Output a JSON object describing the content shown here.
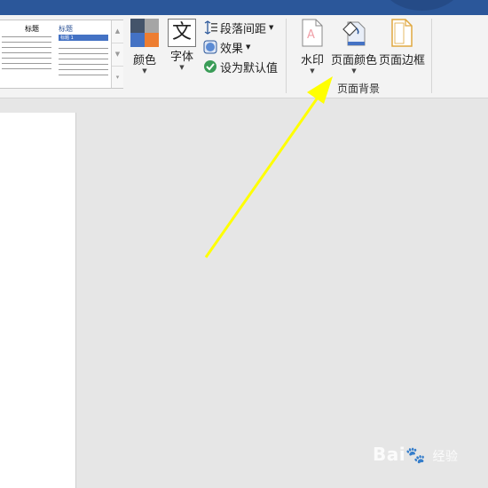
{
  "ribbon": {
    "styles_gallery": {
      "theme1_title": "标题",
      "theme2_title": "标题",
      "theme2_heading": "标题 1"
    },
    "colors_label": "颜色",
    "fonts_label": "字体",
    "fonts_glyph": "文",
    "paragraph_spacing_label": "段落间距",
    "effects_label": "效果",
    "set_default_label": "设为默认值",
    "watermark_label": "水印",
    "page_color_label": "页面颜色",
    "page_borders_label": "页面边框",
    "group_label": "页面背景"
  },
  "watermark_text": "Bai",
  "watermark_suffix": "经验",
  "colors": {
    "title_bar": "#2b579a",
    "arrow": "#ffff00",
    "theme_swatches": [
      "#44546a",
      "#a5a5a5",
      "#4472c4",
      "#ed7d31"
    ]
  }
}
